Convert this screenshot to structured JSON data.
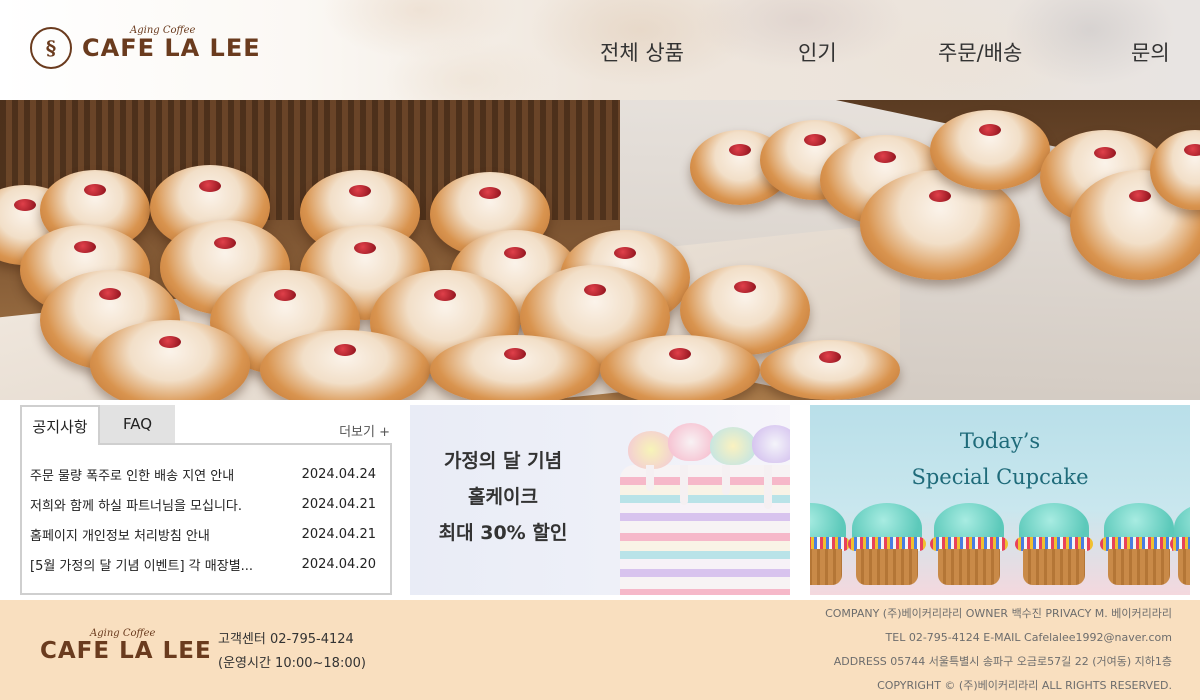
{
  "header": {
    "logo_tagline": "Aging Coffee",
    "logo_name": "CAFE LA LEE",
    "nav": [
      "전체 상품",
      "인기",
      "주문/배송",
      "문의"
    ]
  },
  "notice": {
    "tabs": [
      "공지사항",
      "FAQ"
    ],
    "more_label": "더보기 +",
    "items": [
      {
        "title": "주문 물량 폭주로 인한 배송 지연 안내",
        "date": "2024.04.24"
      },
      {
        "title": "저희와 함께 하실 파트너님을 모십니다.",
        "date": "2024.04.21"
      },
      {
        "title": "홈페이지 개인정보 처리방침 안내",
        "date": "2024.04.21"
      },
      {
        "title": "[5월 가정의 달 기념 이벤트] 각 매장별...",
        "date": "2024.04.20"
      }
    ]
  },
  "promo_cake": {
    "line1": "가정의 달 기념",
    "line2": "홀케이크",
    "line3": "최대 30% 할인"
  },
  "promo_cupcake": {
    "line1": "Today’s",
    "line2": "Special Cupcake"
  },
  "footer": {
    "logo_tagline": "Aging Coffee",
    "logo_name": "CAFE LA LEE",
    "cs_phone": "고객센터 02-795-4124",
    "cs_hours": "(운영시간 10:00~18:00)",
    "info": [
      "COMPANY (주)베이커리라리 OWNER 백수진 PRIVACY M. 베이커리라리",
      "TEL 02-795-4124 E-MAIL Cafelalee1992@naver.com",
      "ADDRESS 05744 서울특별시 송파구 오금로57길 22 (거여동) 지하1층",
      "COPYRIGHT © (주)베이커리라리 ALL RIGHTS RESERVED."
    ]
  }
}
